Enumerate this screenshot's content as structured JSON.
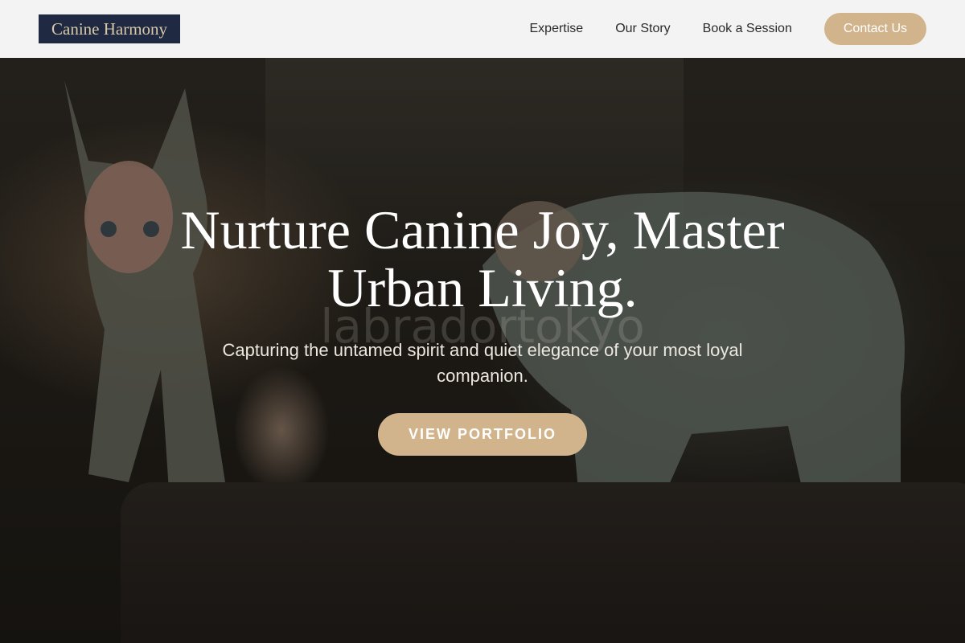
{
  "header": {
    "logo": "Canine Harmony",
    "nav": [
      "Expertise",
      "Our Story",
      "Book a Session"
    ],
    "contact_label": "Contact Us"
  },
  "hero": {
    "headline": "Nurture Canine Joy, Master Urban Living.",
    "subtitle": "Capturing the untamed spirit and quiet elegance of your most loyal companion.",
    "cta_label": "VIEW PORTFOLIO",
    "watermark": "labradortokyo"
  },
  "colors": {
    "header_bg": "#f3f3f3",
    "logo_bg": "#1f2942",
    "logo_text": "#d9c9a8",
    "accent": "#d2b48c",
    "headline": "#ffffff"
  }
}
